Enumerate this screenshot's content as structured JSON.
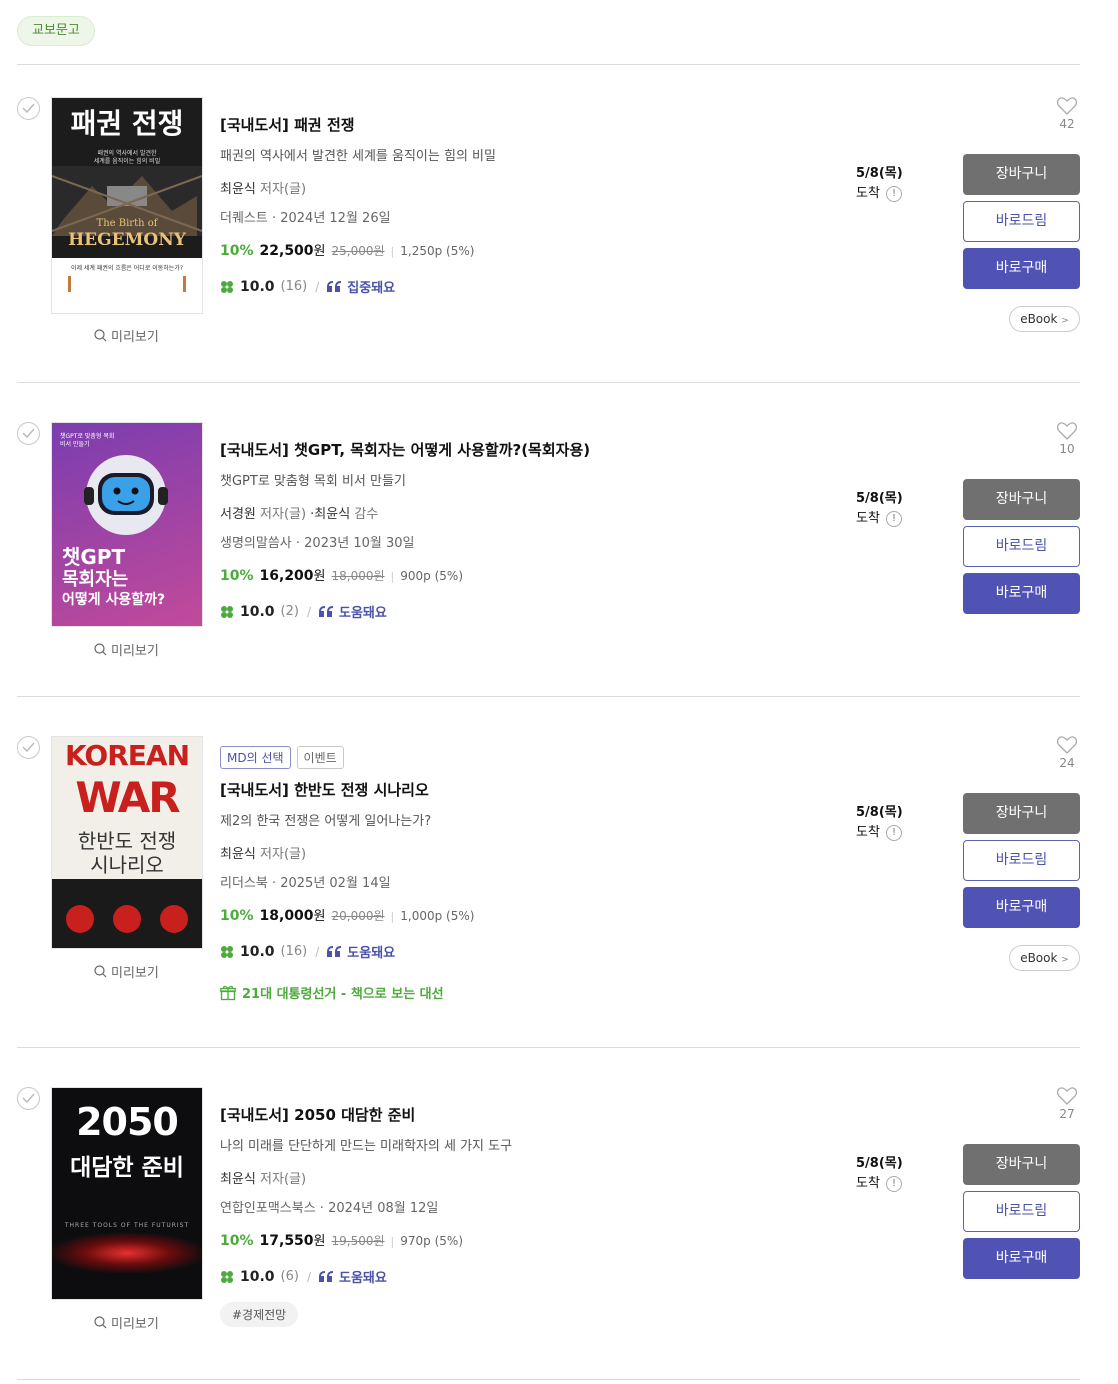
{
  "store_tag": "교보문고",
  "books": [
    {
      "title": "[국내도서] 패권 전쟁",
      "subtitle": "패권의 역사에서 발견한 세계를 움직이는 힘의 비밀",
      "author": "최윤식",
      "author_role": " 저자(글)",
      "publisher_date": "더퀘스트 · 2024년 12월 26일",
      "discount": "10%",
      "price": "22,500",
      "won": "원",
      "original_price": "25,000원",
      "points": "1,250p (5%)",
      "rating": "10.0",
      "rating_count": "(16)",
      "review": "집중돼요",
      "likes": "42",
      "delivery_date": "5/8(목)",
      "delivery_label": "도착",
      "ebook": "eBook",
      "cover": {
        "line1": "패권 전쟁",
        "line2": "패권의 역사에서 발견한",
        "line3": "세계를 움직이는 힘의 비밀",
        "line4": "The Birth of",
        "line5": "HEGEMONY",
        "line6": "이제 세계 패권의 흐름은 어디로 이동하는가?"
      }
    },
    {
      "title": "[국내도서] 챗GPT, 목회자는 어떻게 사용할까?(목회자용)",
      "subtitle": "챗GPT로 맞춤형 목회 비서 만들기",
      "author": "서경원",
      "author_role": " 저자(글)",
      "author2": " ·최윤식",
      "author2_role": " 감수",
      "publisher_date": "생명의말씀사 · 2023년 10월 30일",
      "discount": "10%",
      "price": "16,200",
      "won": "원",
      "original_price": "18,000원",
      "points": "900p (5%)",
      "rating": "10.0",
      "rating_count": "(2)",
      "review": "도움돼요",
      "likes": "10",
      "delivery_date": "5/8(목)",
      "delivery_label": "도착",
      "cover": {
        "line1": "챗GPT",
        "line2": "목회자는",
        "line3": "어떻게 사용할까?",
        "line4": "챗GPT로 맞춤형 목회 비서 만들기"
      }
    },
    {
      "badges": [
        "MD의 선택",
        "이벤트"
      ],
      "title": "[국내도서] 한반도 전쟁 시나리오",
      "subtitle": "제2의 한국 전쟁은 어떻게 일어나는가?",
      "author": "최윤식",
      "author_role": " 저자(글)",
      "publisher_date": "리더스북 · 2025년 02월 14일",
      "discount": "10%",
      "price": "18,000",
      "won": "원",
      "original_price": "20,000원",
      "points": "1,000p (5%)",
      "rating": "10.0",
      "rating_count": "(16)",
      "review": "도움돼요",
      "event": "21대 대통령선거 - 책으로 보는 대선",
      "likes": "24",
      "delivery_date": "5/8(목)",
      "delivery_label": "도착",
      "ebook": "eBook",
      "cover": {
        "line1": "KOREAN",
        "line2": "WAR",
        "line3": "한반도 전쟁",
        "line4": "시나리오"
      }
    },
    {
      "title": "[국내도서] 2050 대담한 준비",
      "subtitle": "나의 미래를 단단하게 만드는 미래학자의 세 가지 도구",
      "author": "최윤식",
      "author_role": " 저자(글)",
      "publisher_date": "연합인포맥스북스 · 2024년 08월 12일",
      "discount": "10%",
      "price": "17,550",
      "won": "원",
      "original_price": "19,500원",
      "points": "970p (5%)",
      "rating": "10.0",
      "rating_count": "(6)",
      "review": "도움돼요",
      "hashtag": "#경제전망",
      "likes": "27",
      "delivery_date": "5/8(목)",
      "delivery_label": "도착",
      "cover": {
        "line1": "2050",
        "line2": "대담한 준비",
        "line3": "THREE TOOLS OF THE FUTURIST"
      }
    }
  ],
  "buttons": {
    "cart": "장바구니",
    "gift": "바로드림",
    "buy": "바로구매",
    "preview": "미리보기"
  }
}
